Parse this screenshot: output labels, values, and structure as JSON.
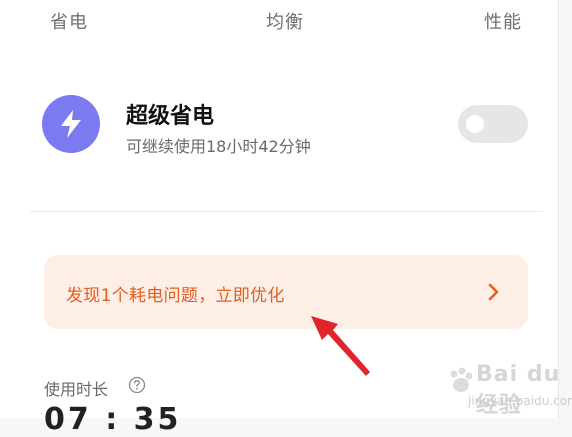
{
  "mode_tabs": {
    "save": "省电",
    "balance": "均衡",
    "performance": "性能"
  },
  "super_saver": {
    "title": "超级省电",
    "subtitle": "可继续使用18小时42分钟",
    "toggle_on": false
  },
  "alert": {
    "text": "发现1个耗电问题，立即优化",
    "chevron": "›"
  },
  "usage": {
    "label": "使用时长",
    "value": "07 : 35"
  },
  "watermark": {
    "main": "Bai du 经验",
    "sub": "jingyan.baidu.com"
  },
  "colors": {
    "accent_purple": "#7b7af0",
    "alert_bg": "#fdeee6",
    "alert_text": "#e35f1f",
    "annotation_arrow": "#e0242b"
  },
  "icons": {
    "super_saver": "lightning-bolt-icon",
    "alert_arrow": "chevron-right-icon",
    "usage_help": "question-circle-icon",
    "annotation": "red-arrow-annotation"
  }
}
